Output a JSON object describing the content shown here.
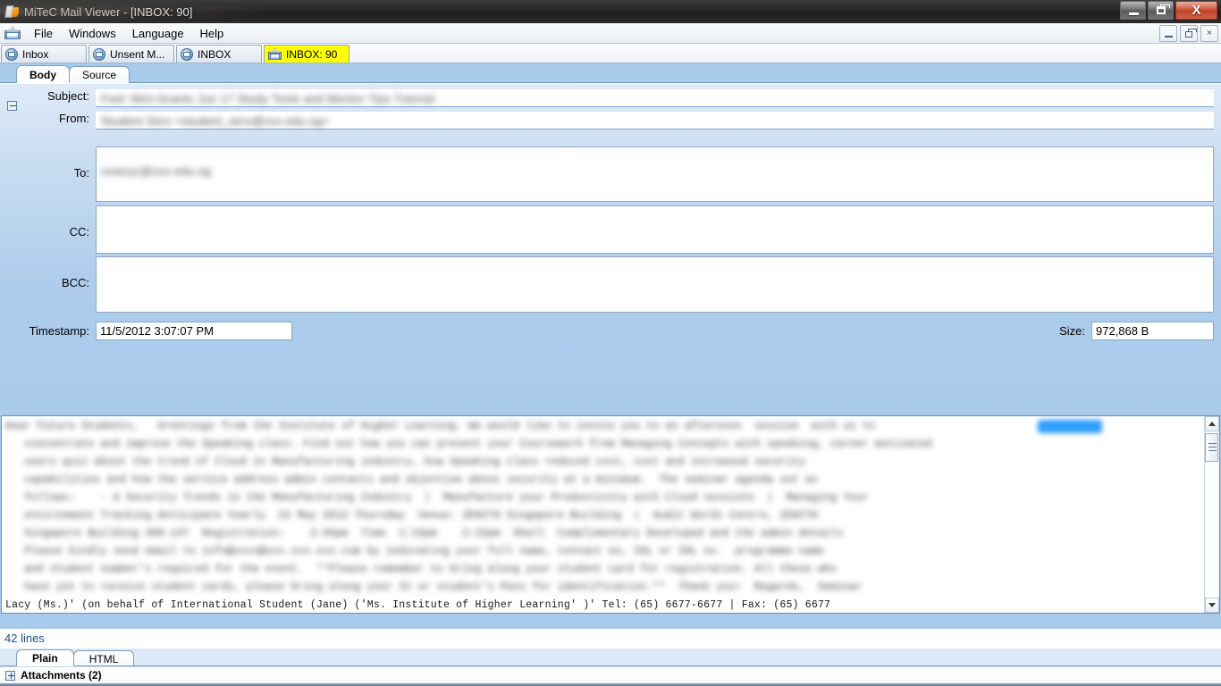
{
  "window": {
    "title": "MiTeC Mail Viewer - [INBOX: 90]",
    "app_icon": "page-flame-icon",
    "controls": {
      "minimize": "minimize-button",
      "restore": "restore-button",
      "close": "close-button"
    }
  },
  "menu": {
    "icon": "open-envelope-icon",
    "items": [
      {
        "label": "File"
      },
      {
        "label": "Windows"
      },
      {
        "label": "Language"
      },
      {
        "label": "Help"
      }
    ],
    "mdi_controls": {
      "minimize": "–",
      "restore": "restore-glyph",
      "close": "×"
    }
  },
  "window_tabs": [
    {
      "label": "Inbox",
      "icon": "mailbox-icon",
      "active": false
    },
    {
      "label": "Unsent M...",
      "icon": "mailbox-icon",
      "active": false
    },
    {
      "label": "INBOX",
      "icon": "mailbox-icon",
      "active": false
    },
    {
      "label": "INBOX: 90",
      "icon": "open-envelope-icon",
      "active": true
    }
  ],
  "view_tabs": [
    {
      "label": "Body",
      "active": true
    },
    {
      "label": "Source",
      "active": false
    }
  ],
  "header_fields": {
    "collapse_toggle": "collapse-header-toggle",
    "subject": {
      "label": "Subject:",
      "value": "",
      "redacted_text": "Fwd:  Mini-Grants  Jun 17 Study Tools and Mentor Tips Tutorial"
    },
    "from": {
      "label": "From:",
      "value": "",
      "redacted_text": "Student Serv <student_serv@xxx.edu.sg>"
    },
    "to": {
      "label": "To:",
      "value": "",
      "redacted_text": "uvwxyz@xxx.edu.sg"
    },
    "cc": {
      "label": "CC:",
      "value": ""
    },
    "bcc": {
      "label": "BCC:",
      "value": ""
    },
    "timestamp": {
      "label": "Timestamp:",
      "value": "11/5/2012 3:07:07 PM"
    },
    "size": {
      "label": "Size:",
      "value": "972,868 B"
    }
  },
  "body": {
    "selection_highlight_color": "#2f9dff",
    "redacted_lines": [
      "Dear Future Students,   Greetings from the Institute of Higher Learning. We would like to invite you to an afternoon  session  with us to",
      "   concentrate and improve the Speaking class. Find out how you can present your Coursework from Managing Concepts with speaking, career motivated",
      "   users quiz about the trend of Cloud in Manufacturing industry, how Speaking class reduced cost, cost and increased security",
      "   capabilities and how the service address admin contacts and objective about security at a minimum.  The seminar agenda set as",
      "   follows:    - A Security Trends in the Manufacturing Industry  |  Manufacture your Productivity with Cloud sessions  |  Managing Your",
      "   environment Tracking Anticipate Yearly  22 May 2012 Thursday  Venue: ZENITH Singapore Building  |  Audit Words Centre, ZENITH",
      "   Singapore Building 409-147  Registration:    2:45pm  Time  1:15pm    2:15pm  Shall  Complimentary Developed and the admin details",
      "   Please kindly send email to info@xxxx@xxx.xxx.xxx.com by indicating your full name, contact no, IHL or IHL no.  programme name",
      "   and student number's required for the event.  **Please remember to bring along your student card for registration. All these who",
      "   have yet to receive student cards, please bring along your IC or student's Pass for identification.**  Thank you!  Regards,  Seminar"
    ],
    "visible_sharp_line": "Lacy (Ms.)' (on behalf of International Student (Jane) ('Ms. Institute of Higher Learning' )' Tel: (65) 6677-6677 | Fax: (65) 6677",
    "scrollbar": {
      "up_arrow": "scroll-up-arrow",
      "down_arrow": "scroll-down-arrow",
      "thumb": "scroll-thumb"
    }
  },
  "footer": {
    "lines_count": "42 lines",
    "format_tabs": [
      {
        "label": "Plain",
        "active": true
      },
      {
        "label": "HTML",
        "active": false
      }
    ],
    "attachments": {
      "expand_toggle": "expand-attachments-toggle",
      "label": "Attachments (2)"
    }
  },
  "colors": {
    "panel_blue": "#a8caeb",
    "active_tab_yellow": "#ffff00",
    "link_blue": "#1c4f8c",
    "close_red": "#cd5236",
    "selection_blue": "#2f9dff"
  }
}
